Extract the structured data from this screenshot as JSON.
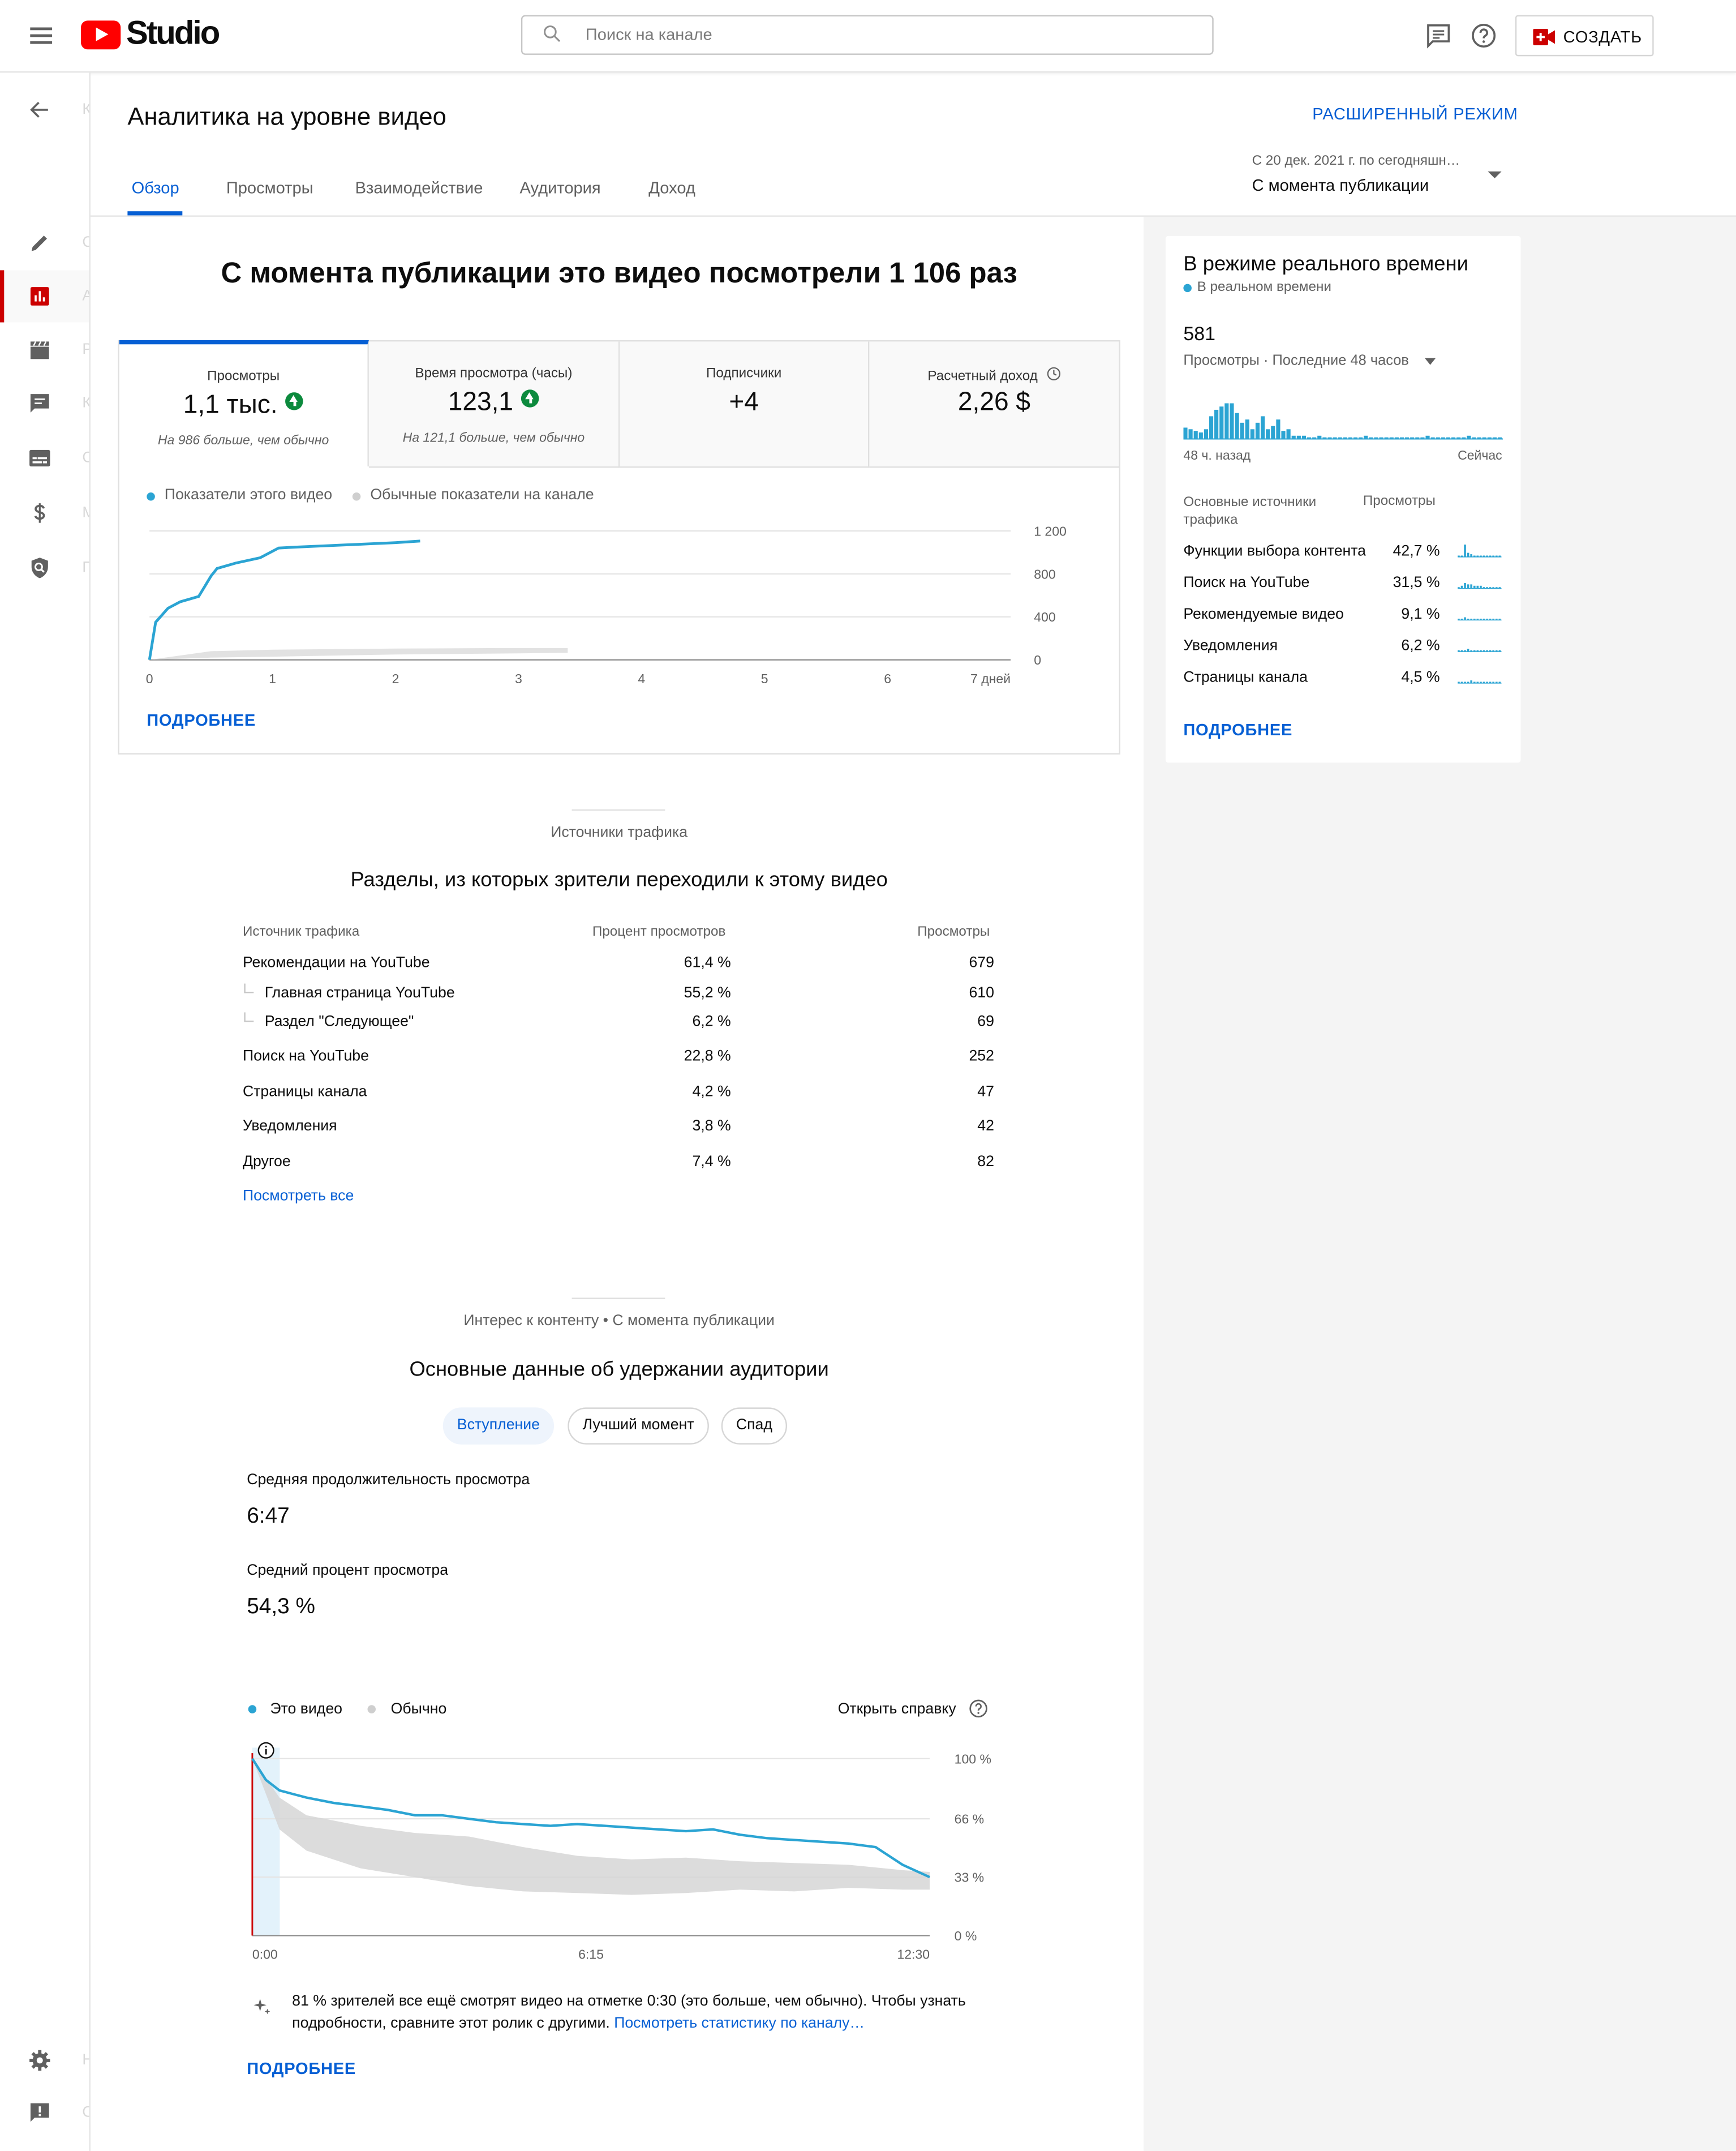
{
  "topbar": {
    "logo_text": "Studio",
    "search_placeholder": "Поиск на канале",
    "create_label": "СОЗДАТЬ",
    "brand_color": "#ff0000",
    "accent_color": "#065fd4"
  },
  "header": {
    "title": "Аналитика на уровне видео",
    "advanced_mode": "РАСШИРЕННЫЙ РЕЖИМ",
    "tabs": [
      "Обзор",
      "Просмотры",
      "Взаимодействие",
      "Аудитория",
      "Доход"
    ],
    "active_tab": "Обзор",
    "date_range_caption": "С 20 дек. 2021 г. по сегодняшн…",
    "date_range_value": "С момента публикации"
  },
  "sidebar": {
    "icons": [
      "back-arrow-icon",
      "pencil-icon",
      "analytics-icon",
      "clapperboard-icon",
      "comments-icon",
      "subtitles-icon",
      "dollar-icon",
      "copyright-shield-icon",
      "settings-icon",
      "feedback-icon"
    ],
    "ghost_letters": [
      "К",
      "С",
      "А",
      "Р",
      "К",
      "С",
      "М",
      "П",
      "Н",
      "О"
    ]
  },
  "overview": {
    "headline": "С момента публикации это видео посмотрели 1 106 раз",
    "metrics": [
      {
        "label": "Просмотры",
        "value": "1,1 тыс.",
        "sub": "На 986 больше, чем обычно",
        "trend": "up"
      },
      {
        "label": "Время просмотра (часы)",
        "value": "123,1",
        "sub": "На 121,1 больше, чем обычно",
        "trend": "up"
      },
      {
        "label": "Подписчики",
        "value": "+4",
        "sub": "",
        "trend": ""
      },
      {
        "label": "Расчетный доход",
        "value": "2,26 $",
        "sub": "",
        "trend": ""
      }
    ],
    "legend_this": "Показатели этого видео",
    "legend_typical": "Обычные показатели на канале",
    "more_link": "ПОДРОБНЕЕ"
  },
  "chart_data": [
    {
      "type": "line",
      "title": "",
      "xlabel": "",
      "ylabel": "",
      "x_ticks": [
        "0",
        "1",
        "2",
        "3",
        "4",
        "5",
        "6",
        "7 дней"
      ],
      "y_ticks": [
        "0",
        "400",
        "800",
        "1 200"
      ],
      "xlim": [
        0,
        7
      ],
      "ylim": [
        0,
        1200
      ],
      "grid": true,
      "legend": "top-left",
      "series": [
        {
          "name": "Показатели этого видео",
          "color": "#2ba4d3",
          "x": [
            0,
            0.05,
            0.15,
            0.25,
            0.4,
            0.5,
            0.55,
            0.7,
            0.9,
            1.05,
            1.2,
            1.4,
            1.6,
            1.8,
            2.0,
            2.2
          ],
          "y": [
            0,
            350,
            480,
            540,
            590,
            780,
            850,
            900,
            950,
            1040,
            1050,
            1060,
            1070,
            1080,
            1090,
            1106
          ]
        },
        {
          "name": "Обычные показатели на канале",
          "color": "#d6d6d6",
          "type": "area",
          "x": [
            0,
            0.5,
            1,
            2,
            3,
            3.4
          ],
          "y_low": [
            0,
            20,
            30,
            50,
            60,
            65
          ],
          "y_high": [
            0,
            80,
            95,
            105,
            110,
            110
          ]
        }
      ]
    },
    {
      "type": "area",
      "title": "",
      "x_labels": [
        "48 ч. назад",
        "Сейчас"
      ],
      "series": [
        {
          "name": "Просмотры",
          "color": "#2ba4d3",
          "values": [
            7,
            6,
            5,
            4,
            6,
            14,
            18,
            20,
            22,
            22,
            16,
            10,
            12,
            6,
            10,
            14,
            6,
            8,
            12,
            5,
            6,
            2,
            2,
            2,
            1,
            1,
            2,
            1,
            1,
            1,
            1,
            1,
            1,
            1,
            1,
            2,
            1,
            1,
            1,
            1,
            1,
            1,
            1,
            1,
            1,
            1,
            1,
            2,
            1,
            1,
            1,
            1,
            1,
            1,
            1,
            2,
            1,
            1,
            1,
            1,
            1,
            1
          ]
        }
      ]
    },
    {
      "type": "line",
      "title": "",
      "x_ticks": [
        "0:00",
        "6:15",
        "12:30"
      ],
      "y_ticks": [
        "0 %",
        "33 %",
        "66 %",
        "100 %"
      ],
      "ylim": [
        0,
        100
      ],
      "grid": true,
      "legend": "top-left",
      "series": [
        {
          "name": "Это видео",
          "color": "#2ba4d3",
          "x": [
            0,
            0.25,
            0.5,
            0.75,
            1,
            1.5,
            2,
            2.5,
            3,
            3.5,
            4,
            4.5,
            5,
            5.5,
            6,
            6.5,
            7,
            7.5,
            8,
            8.5,
            9,
            9.5,
            10,
            10.5,
            11,
            11.5,
            12,
            12.5
          ],
          "y": [
            100,
            88,
            82,
            80,
            78,
            75,
            73,
            71,
            68,
            68,
            66,
            64,
            63,
            62,
            63,
            62,
            61,
            60,
            59,
            60,
            57,
            55,
            54,
            53,
            52,
            50,
            40,
            33
          ]
        },
        {
          "name": "Обычно",
          "color": "#d6d6d6",
          "type": "area",
          "x": [
            0,
            0.5,
            1,
            2,
            3,
            4,
            5,
            6,
            7,
            8,
            9,
            10,
            11,
            12,
            12.5
          ],
          "y_low": [
            100,
            60,
            48,
            38,
            33,
            28,
            25,
            24,
            23,
            24,
            26,
            25,
            27,
            26,
            26
          ],
          "y_high": [
            100,
            78,
            68,
            62,
            58,
            56,
            50,
            45,
            43,
            44,
            42,
            41,
            40,
            37,
            36
          ]
        }
      ]
    }
  ],
  "traffic": {
    "caption": "Источники трафика",
    "title": "Разделы, из которых зрители переходили к этому видео",
    "columns": [
      "Источник трафика",
      "Процент просмотров",
      "Просмотры"
    ],
    "rows": [
      {
        "source": "Рекомендации на YouTube",
        "percent": "61,4 %",
        "views": "679",
        "child": false
      },
      {
        "source": "Главная страница YouTube",
        "percent": "55,2 %",
        "views": "610",
        "child": true
      },
      {
        "source": "Раздел \"Следующее\"",
        "percent": "6,2 %",
        "views": "69",
        "child": true
      },
      {
        "source": "Поиск на YouTube",
        "percent": "22,8 %",
        "views": "252",
        "child": false
      },
      {
        "source": "Страницы канала",
        "percent": "4,2 %",
        "views": "47",
        "child": false
      },
      {
        "source": "Уведомления",
        "percent": "3,8 %",
        "views": "42",
        "child": false
      },
      {
        "source": "Другое",
        "percent": "7,4 %",
        "views": "82",
        "child": false
      }
    ],
    "see_all": "Посмотреть все"
  },
  "retention": {
    "caption": "Интерес к контенту • С момента публикации",
    "title": "Основные данные об удержании аудитории",
    "chips": [
      "Вступление",
      "Лучший момент",
      "Спад"
    ],
    "active_chip": "Вступление",
    "avg_duration_label": "Средняя продолжительность просмотра",
    "avg_duration_value": "6:47",
    "avg_percent_label": "Средний процент просмотра",
    "avg_percent_value": "54,3 %",
    "legend_this": "Это видео",
    "legend_typical": "Обычно",
    "help_link": "Открыть справку",
    "insight_text": "81 % зрителей все ещё смотрят видео на отметке 0:30 (это больше, чем обычно). Чтобы узнать подробности, сравните этот ролик с другими.",
    "insight_link": "Посмотреть статистику по каналу…",
    "more_link": "ПОДРОБНЕЕ"
  },
  "realtime": {
    "title": "В режиме реального времени",
    "live_label": "В реальном времени",
    "count": "581",
    "metric_selector": "Просмотры · Последние 48 часов",
    "x_start": "48 ч. назад",
    "x_end": "Сейчас",
    "col_source": "Основные источники трафика",
    "col_views": "Просмотры",
    "sources": [
      {
        "name": "Функции выбора контента",
        "percent": "42,7 %"
      },
      {
        "name": "Поиск на YouTube",
        "percent": "31,5 %"
      },
      {
        "name": "Рекомендуемые видео",
        "percent": "9,1 %"
      },
      {
        "name": "Уведомления",
        "percent": "6,2 %"
      },
      {
        "name": "Страницы канала",
        "percent": "4,5 %"
      }
    ],
    "more_link": "ПОДРОБНЕЕ"
  }
}
